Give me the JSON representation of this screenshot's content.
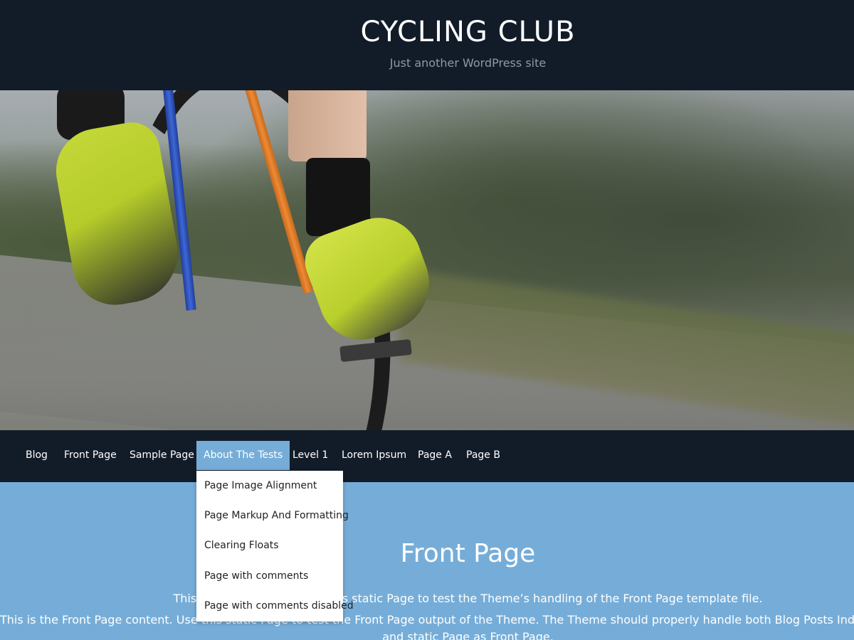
{
  "site": {
    "title": "CYCLING CLUB",
    "tagline": "Just another WordPress site"
  },
  "hero": {
    "image_description_icon": "cyclist-hero-image"
  },
  "nav": {
    "items": [
      {
        "label": "Blog"
      },
      {
        "label": "Front Page"
      },
      {
        "label": "Sample Page"
      },
      {
        "label": "About The Tests",
        "active": true
      },
      {
        "label": "Level 1"
      },
      {
        "label": "Lorem Ipsum"
      },
      {
        "label": "Page A"
      },
      {
        "label": "Page B"
      }
    ],
    "submenu": [
      {
        "label": "Page Image Alignment"
      },
      {
        "label": "Page Markup And Formatting"
      },
      {
        "label": "Clearing Floats"
      },
      {
        "label": "Page with comments"
      },
      {
        "label": "Page with comments disabled"
      }
    ]
  },
  "content": {
    "title": "Front Page",
    "line1": "This is the Front Page. Use this static Page to test the Theme’s handling of the Front Page template file.",
    "line2": "This is the Front Page content. Use this static Page to test the Front Page output of the Theme. The Theme should properly handle both Blog Posts Index as Front Page",
    "line3": "and static Page as Front Page."
  },
  "colors": {
    "header_bg": "#121c29",
    "accent": "#76add8",
    "text_light": "#ffffff"
  }
}
